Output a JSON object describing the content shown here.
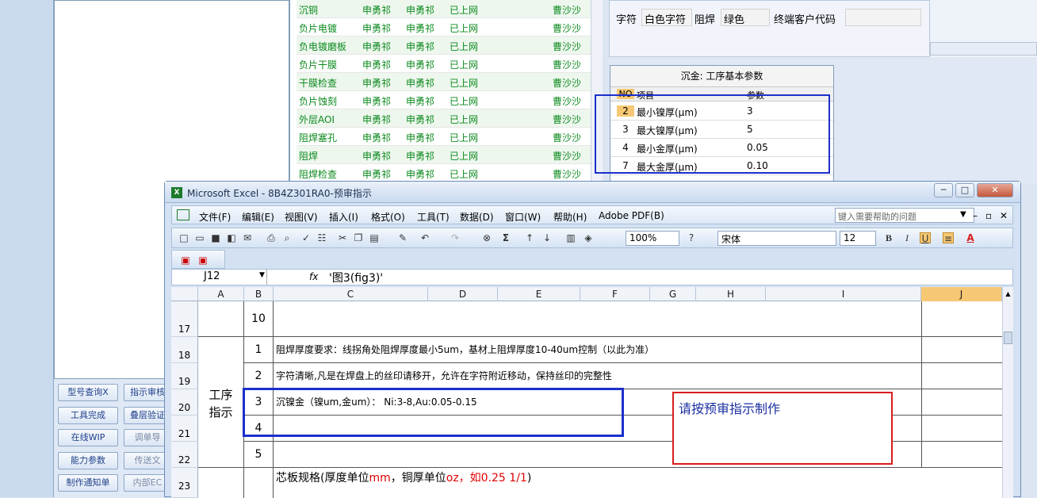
{
  "left_buttons": [
    {
      "label": "型号查询X",
      "dim": false
    },
    {
      "label": "指示审核",
      "dim": false
    },
    {
      "label": "工具完成",
      "dim": false
    },
    {
      "label": "叠层验证",
      "dim": false
    },
    {
      "label": "在线WIP",
      "dim": false
    },
    {
      "label": "调单导",
      "dim": true
    },
    {
      "label": "能力参数",
      "dim": false
    },
    {
      "label": "传送文",
      "dim": true
    },
    {
      "label": "制作通知单",
      "dim": false
    },
    {
      "label": "内部EC",
      "dim": true
    }
  ],
  "process_rows": [
    {
      "name": "沉铜",
      "a": "申勇祁",
      "b": "申勇祁",
      "status": "已上网",
      "user": "曹沙沙"
    },
    {
      "name": "负片电镀",
      "a": "申勇祁",
      "b": "申勇祁",
      "status": "已上网",
      "user": "曹沙沙"
    },
    {
      "name": "负电镀磨板",
      "a": "申勇祁",
      "b": "申勇祁",
      "status": "已上网",
      "user": "曹沙沙"
    },
    {
      "name": "负片干膜",
      "a": "申勇祁",
      "b": "申勇祁",
      "status": "已上网",
      "user": "曹沙沙"
    },
    {
      "name": "干膜检查",
      "a": "申勇祁",
      "b": "申勇祁",
      "status": "已上网",
      "user": "曹沙沙"
    },
    {
      "name": "负片蚀刻",
      "a": "申勇祁",
      "b": "申勇祁",
      "status": "已上网",
      "user": "曹沙沙"
    },
    {
      "name": "外层AOI",
      "a": "申勇祁",
      "b": "申勇祁",
      "status": "已上网",
      "user": "曹沙沙"
    },
    {
      "name": "阻焊塞孔",
      "a": "申勇祁",
      "b": "申勇祁",
      "status": "已上网",
      "user": "曹沙沙"
    },
    {
      "name": "阻焊",
      "a": "申勇祁",
      "b": "申勇祁",
      "status": "已上网",
      "user": "曹沙沙"
    },
    {
      "name": "阻焊检查",
      "a": "申勇祁",
      "b": "申勇祁",
      "status": "已上网",
      "user": "曹沙沙"
    }
  ],
  "right_top": {
    "label1": "字符",
    "value1": "白色字符",
    "label2": "阻焊",
    "value2": "绿色",
    "label3": "终端客户代码",
    "value3": ""
  },
  "params": {
    "title": "沉金: 工序基本参数",
    "headers": {
      "no": "NO",
      "item": "项目",
      "value": "参数"
    },
    "rows": [
      {
        "no": "2",
        "item": "最小镍厚(μm)",
        "value": "3"
      },
      {
        "no": "3",
        "item": "最大镍厚(μm)",
        "value": "5"
      },
      {
        "no": "4",
        "item": "最小金厚(μm)",
        "value": "0.05"
      },
      {
        "no": "7",
        "item": "最大金厚(μm)",
        "value": "0.10"
      }
    ]
  },
  "excel": {
    "title": "Microsoft Excel - 8B4Z301RA0-预审指示",
    "window_buttons": {
      "min": "─",
      "max": "□",
      "close": "✕"
    },
    "menu": [
      "文件(F)",
      "编辑(E)",
      "视图(V)",
      "插入(I)",
      "格式(O)",
      "工具(T)",
      "数据(D)",
      "窗口(W)",
      "帮助(H)",
      "Adobe PDF(B)"
    ],
    "help_placeholder": "键入需要帮助的问题",
    "zoom": "100%",
    "font": "宋体",
    "font_size": "12",
    "bold": "B",
    "italic": "I",
    "underline": "U",
    "name_box": "J12",
    "fx": "fx",
    "formula": "'图3(fig3)'",
    "columns": [
      "A",
      "B",
      "C",
      "D",
      "E",
      "F",
      "G",
      "H",
      "I",
      "J"
    ],
    "rows": [
      {
        "num": "17",
        "b": "10",
        "c": ""
      },
      {
        "num": "18",
        "b": "1",
        "c": "阻焊厚度要求：线拐角处阻焊厚度最小5um，基材上阻焊厚度10-40um控制（以此为准）"
      },
      {
        "num": "19",
        "b": "2",
        "c": "字符清晰,凡是在焊盘上的丝印请移开，允许在字符附近移动，保持丝印的完整性"
      },
      {
        "num": "20",
        "b": "3",
        "c": "沉镍金（镍um,金um）： Ni:3-8,Au:0.05-0.15"
      },
      {
        "num": "21",
        "b": "4",
        "c": ""
      },
      {
        "num": "22",
        "b": "5",
        "c": ""
      }
    ],
    "merged_a": "工序\n指示",
    "row23": {
      "num": "23",
      "c_part1": "芯板规格(厚度单位",
      "c_part2": "mm",
      "c_part3": "，铜厚单位",
      "c_part4": "oz",
      "c_part5": "，如0.25 1/1",
      ")": ")"
    },
    "annotation": "请按预审指示制作"
  },
  "colors": {
    "green_text": "#0c8a1e",
    "blue_box": "#1b2fcc",
    "red_box": "#d81c1c",
    "red_text": "#e00000"
  }
}
